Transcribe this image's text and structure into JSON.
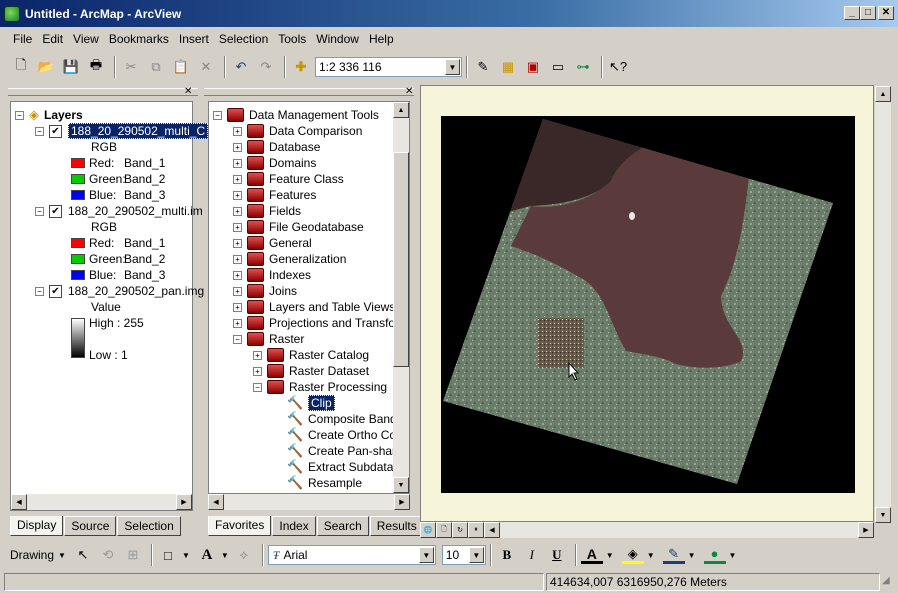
{
  "window": {
    "title": "Untitled - ArcMap - ArcView",
    "min": "_",
    "max": "□",
    "close": "✕"
  },
  "menu": [
    "File",
    "Edit",
    "View",
    "Bookmarks",
    "Insert",
    "Selection",
    "Tools",
    "Window",
    "Help"
  ],
  "toolbar": {
    "scale": "1:2 336 116"
  },
  "toc": {
    "root": "Layers",
    "layer1": {
      "name": "188_20_290502_multi_C",
      "sub": "RGB",
      "red": "Red:",
      "red_band": "Band_1",
      "green": "Green:",
      "green_band": "Band_2",
      "blue": "Blue:",
      "blue_band": "Band_3"
    },
    "layer2": {
      "name": "188_20_290502_multi.im",
      "sub": "RGB",
      "red": "Red:",
      "red_band": "Band_1",
      "green": "Green:",
      "green_band": "Band_2",
      "blue": "Blue:",
      "blue_band": "Band_3"
    },
    "layer3": {
      "name": "188_20_290502_pan.img",
      "sub": "Value",
      "high": "High : 255",
      "low": "Low : 1"
    },
    "tabs": [
      "Display",
      "Source",
      "Selection"
    ]
  },
  "toolbox": {
    "root": "Data Management Tools",
    "items": [
      "Data Comparison",
      "Database",
      "Domains",
      "Feature Class",
      "Features",
      "Fields",
      "File Geodatabase",
      "General",
      "Generalization",
      "Indexes",
      "Joins",
      "Layers and Table Views",
      "Projections and Transform",
      "Raster"
    ],
    "raster_items": [
      "Raster Catalog",
      "Raster Dataset",
      "Raster Processing"
    ],
    "tools": [
      "Clip",
      "Composite Bands",
      "Create Ortho Corr",
      "Create Pan-sharp",
      "Extract Subdatase",
      "Resample"
    ],
    "tabs": [
      "Favorites",
      "Index",
      "Search",
      "Results"
    ]
  },
  "drawing": {
    "label": "Drawing",
    "font": "Arial",
    "size": "10",
    "bold": "B",
    "italic": "I",
    "underline": "U",
    "fontcolor": "A"
  },
  "status": {
    "coords": "414634,007  6316950,276 Meters"
  },
  "colors": {
    "red": "#ff0000",
    "green": "#00cc00",
    "blue": "#0000ff",
    "map_bg": "#f7f5d9"
  }
}
